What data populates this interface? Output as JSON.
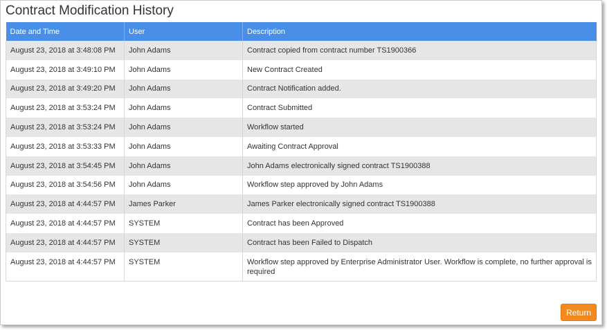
{
  "dialog": {
    "title": "Contract Modification History",
    "return_label": "Return"
  },
  "table": {
    "headers": [
      "Date and Time",
      "User",
      "Description"
    ],
    "rows": [
      [
        "August 23, 2018 at 3:48:08 PM",
        "John Adams",
        "Contract copied from contract number TS1900366"
      ],
      [
        "August 23, 2018 at 3:49:10 PM",
        "John Adams",
        "New Contract Created"
      ],
      [
        "August 23, 2018 at 3:49:20 PM",
        "John Adams",
        "Contract Notification added."
      ],
      [
        "August 23, 2018 at 3:53:24 PM",
        "John Adams",
        "Contract Submitted"
      ],
      [
        "August 23, 2018 at 3:53:24 PM",
        "John Adams",
        "Workflow started"
      ],
      [
        "August 23, 2018 at 3:53:33 PM",
        "John Adams",
        "Awaiting Contract Approval"
      ],
      [
        "August 23, 2018 at 3:54:45 PM",
        "John Adams",
        "John Adams electronically signed contract TS1900388"
      ],
      [
        "August 23, 2018 at 3:54:56 PM",
        "John Adams",
        "Workflow step approved by John Adams"
      ],
      [
        "August 23, 2018 at 4:44:57 PM",
        "James Parker",
        "James Parker electronically signed contract TS1900388"
      ],
      [
        "August 23, 2018 at 4:44:57 PM",
        "SYSTEM",
        "Contract has been Approved"
      ],
      [
        "August 23, 2018 at 4:44:57 PM",
        "SYSTEM",
        "Contract has been Failed to Dispatch"
      ],
      [
        "August 23, 2018 at 4:44:57 PM",
        "SYSTEM",
        "Workflow step approved by Enterprise Administrator User. Workflow is complete, no further approval is required"
      ]
    ]
  },
  "colors": {
    "header_bg": "#4a8fe7",
    "row_alt_bg": "#e6e6e6",
    "button_bg": "#f28a1e"
  }
}
